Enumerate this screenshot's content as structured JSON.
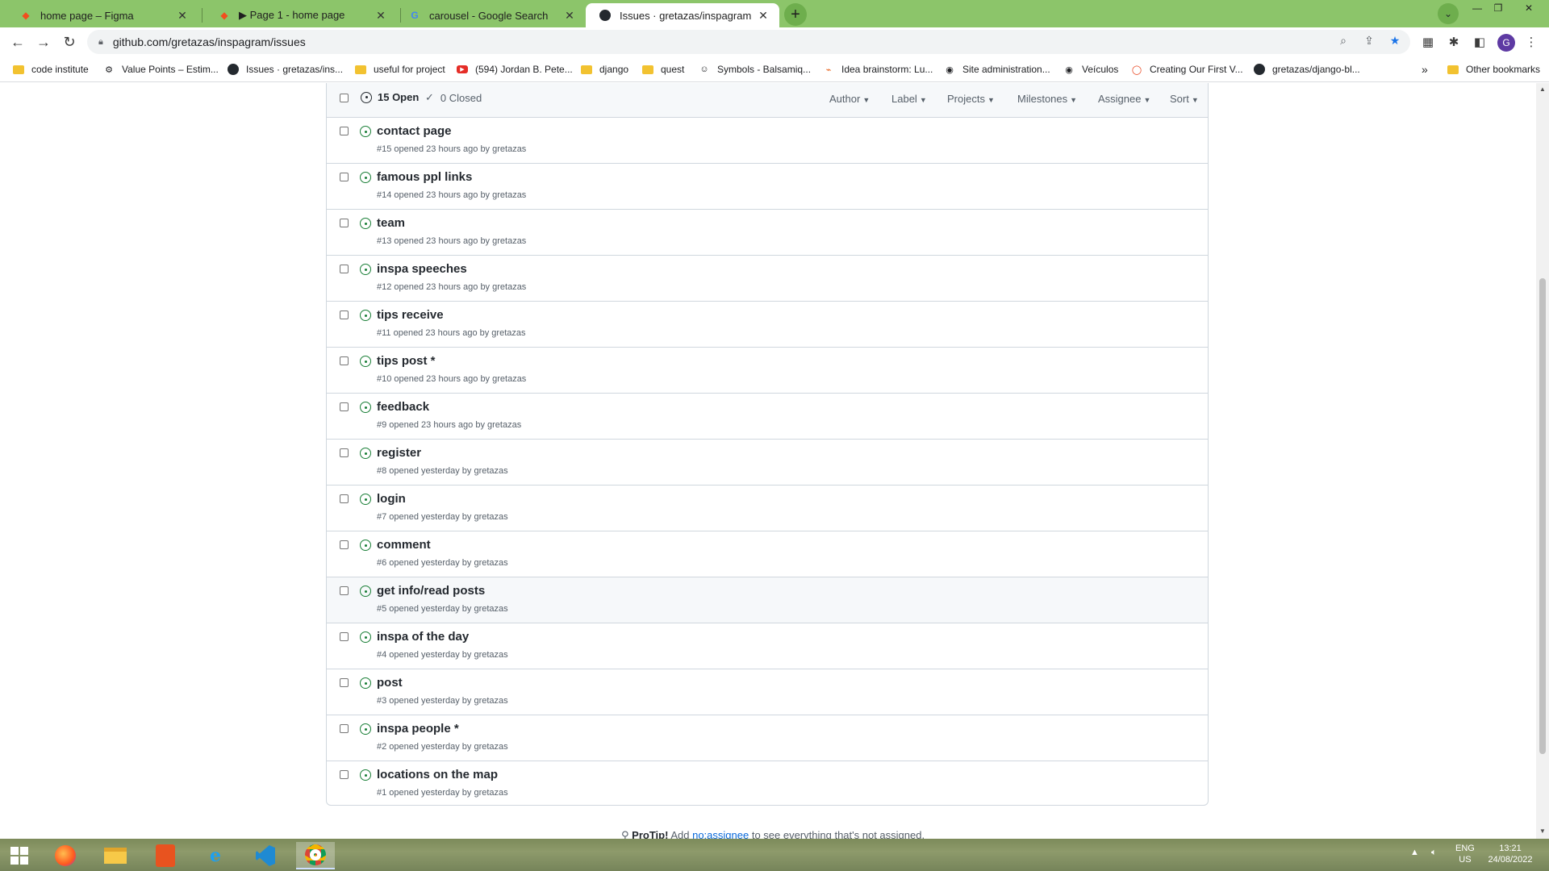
{
  "browser": {
    "tabs": [
      {
        "title": "home page – Figma",
        "icon": "figma-icon",
        "active": false
      },
      {
        "title": "▶ Page 1 - home page",
        "icon": "figma-icon",
        "active": false
      },
      {
        "title": "carousel - Google Search",
        "icon": "google-icon",
        "active": false
      },
      {
        "title": "Issues · gretazas/inspagram",
        "icon": "github-icon",
        "active": true
      }
    ],
    "url": "github.com/gretazas/inspagram/issues",
    "profile_initial": "G",
    "bookmarks": [
      {
        "label": "code institute",
        "icon": "folder-icon"
      },
      {
        "label": "Value Points – Estim...",
        "icon": "image-icon"
      },
      {
        "label": "Issues · gretazas/ins...",
        "icon": "github-icon"
      },
      {
        "label": "useful for project",
        "icon": "folder-icon"
      },
      {
        "label": "(594) Jordan B. Pete...",
        "icon": "youtube-icon"
      },
      {
        "label": "django",
        "icon": "folder-icon"
      },
      {
        "label": "quest",
        "icon": "folder-icon"
      },
      {
        "label": "Symbols - Balsamiq...",
        "icon": "smiley-icon"
      },
      {
        "label": "Idea brainstorm: Lu...",
        "icon": "miro-icon"
      },
      {
        "label": "Site administration...",
        "icon": "globe-icon"
      },
      {
        "label": "Veículos",
        "icon": "globe-icon"
      },
      {
        "label": "Creating Our First V...",
        "icon": "red-ring-icon"
      },
      {
        "label": "gretazas/django-bl...",
        "icon": "github-icon"
      }
    ],
    "bookmarks_overflow": "»",
    "other_bookmarks": "Other bookmarks"
  },
  "issues_header": {
    "open_label": "15 Open",
    "closed_label": "0 Closed",
    "filters": [
      "Author",
      "Label",
      "Projects",
      "Milestones",
      "Assignee",
      "Sort"
    ]
  },
  "issues": [
    {
      "title": "contact page",
      "meta": "#15 opened 23 hours ago by gretazas"
    },
    {
      "title": "famous ppl links",
      "meta": "#14 opened 23 hours ago by gretazas"
    },
    {
      "title": "team",
      "meta": "#13 opened 23 hours ago by gretazas"
    },
    {
      "title": "inspa speeches",
      "meta": "#12 opened 23 hours ago by gretazas"
    },
    {
      "title": "tips receive",
      "meta": "#11 opened 23 hours ago by gretazas"
    },
    {
      "title": "tips post *",
      "meta": "#10 opened 23 hours ago by gretazas"
    },
    {
      "title": "feedback",
      "meta": "#9 opened 23 hours ago by gretazas"
    },
    {
      "title": "register",
      "meta": "#8 opened yesterday by gretazas"
    },
    {
      "title": "login",
      "meta": "#7 opened yesterday by gretazas"
    },
    {
      "title": "comment",
      "meta": "#6 opened yesterday by gretazas"
    },
    {
      "title": "get info/read posts",
      "meta": "#5 opened yesterday by gretazas"
    },
    {
      "title": "inspa of the day",
      "meta": "#4 opened yesterday by gretazas"
    },
    {
      "title": "post",
      "meta": "#3 opened yesterday by gretazas"
    },
    {
      "title": "inspa people *",
      "meta": "#2 opened yesterday by gretazas"
    },
    {
      "title": "locations on the map",
      "meta": "#1 opened yesterday by gretazas"
    }
  ],
  "protip": {
    "label": "ProTip!",
    "pre": "Add",
    "link": "no:assignee",
    "post": "to see everything that's not assigned."
  },
  "taskbar": {
    "apps": [
      "windows-start",
      "firefox",
      "file-explorer",
      "office",
      "internet-explorer",
      "vscode",
      "chrome"
    ],
    "lang_top": "ENG",
    "lang_bottom": "US",
    "time": "13:21",
    "date": "24/08/2022"
  },
  "colors": {
    "tab_strip": "#8cc56a",
    "open_issue_green": "#1a7f37",
    "link_blue": "#0969da"
  }
}
